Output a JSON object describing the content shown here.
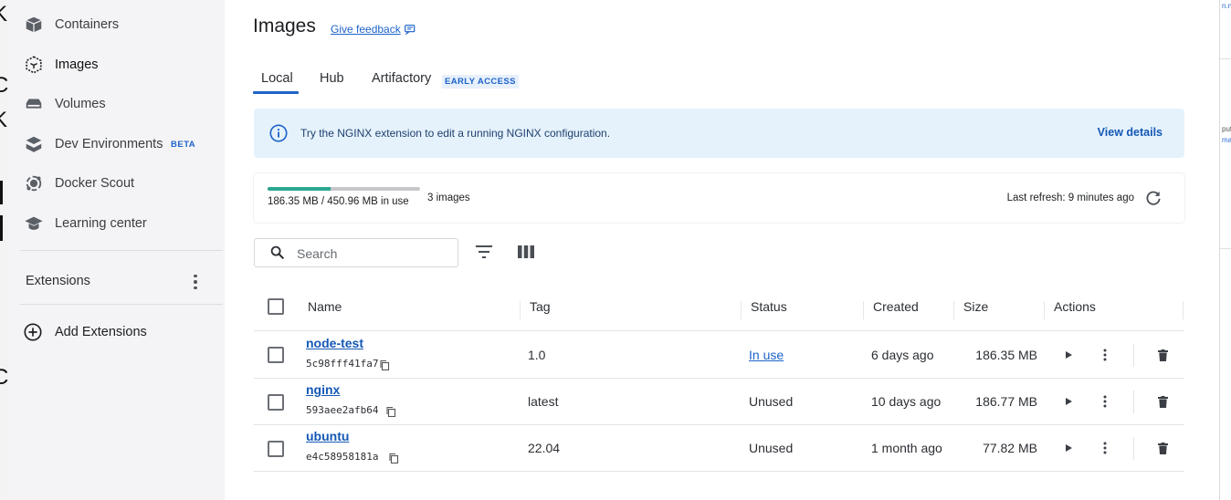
{
  "sidebar": {
    "items": [
      {
        "label": "Containers",
        "icon": "containers-icon"
      },
      {
        "label": "Images",
        "icon": "images-icon",
        "active": true
      },
      {
        "label": "Volumes",
        "icon": "volumes-icon"
      },
      {
        "label": "Dev Environments",
        "icon": "dev-environments-icon",
        "badge": "BETA"
      },
      {
        "label": "Docker Scout",
        "icon": "docker-scout-icon"
      },
      {
        "label": "Learning center",
        "icon": "learning-center-icon"
      }
    ],
    "extensions_title": "Extensions",
    "add_extensions_label": "Add Extensions"
  },
  "page": {
    "title": "Images",
    "feedback_label": "Give feedback"
  },
  "tabs": [
    {
      "label": "Local",
      "active": true
    },
    {
      "label": "Hub"
    },
    {
      "label": "Artifactory",
      "badge": "EARLY ACCESS"
    }
  ],
  "banner": {
    "text": "Try the NGINX extension to edit a running NGINX configuration.",
    "link_label": "View details"
  },
  "usage": {
    "used_text": "186.35 MB / 450.96 MB in use",
    "used_fraction": 0.413,
    "count_text": "3 images",
    "refresh_text": "Last refresh: 9 minutes ago"
  },
  "toolbar": {
    "search_placeholder": "Search"
  },
  "table": {
    "headers": {
      "name": "Name",
      "tag": "Tag",
      "status": "Status",
      "created": "Created",
      "size": "Size",
      "actions": "Actions"
    },
    "rows": [
      {
        "name": "node-test",
        "id": "5c98fff41fa7",
        "tag": "1.0",
        "status": "In use",
        "status_link": true,
        "created": "6 days ago",
        "size": "186.35 MB"
      },
      {
        "name": "nginx",
        "id": "593aee2afb64",
        "tag": "latest",
        "status": "Unused",
        "status_link": false,
        "created": "10 days ago",
        "size": "186.77 MB"
      },
      {
        "name": "ubuntu",
        "id": "e4c58958181a",
        "tag": "22.04",
        "status": "Unused",
        "status_link": false,
        "created": "1 month ago",
        "size": "77.82 MB"
      }
    ]
  },
  "colors": {
    "accent": "#1d63c9",
    "usage_fill": "#2aa890",
    "banner_bg": "#e5f2fc",
    "sidebar_bg": "#f4f4f6"
  }
}
